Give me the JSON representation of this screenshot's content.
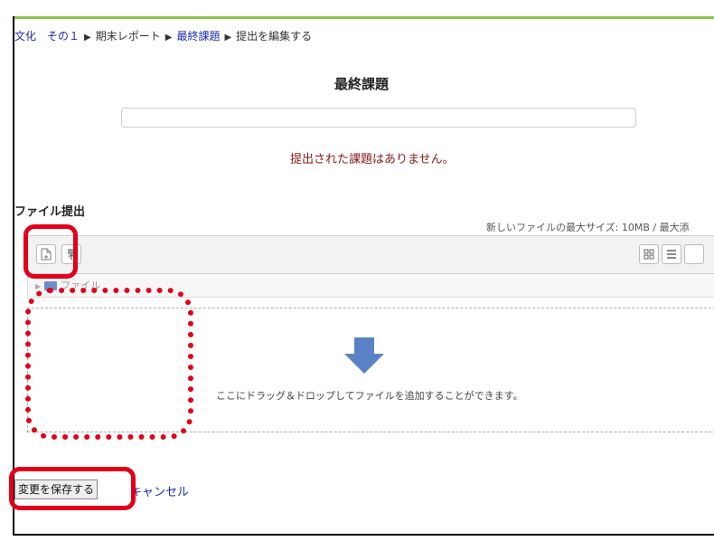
{
  "breadcrumb": {
    "items": [
      {
        "label": "文化　その１",
        "type": "link"
      },
      {
        "label": "期末レポート",
        "type": "plain"
      },
      {
        "label": "最終課題",
        "type": "link"
      },
      {
        "label": "提出を編集する",
        "type": "plain"
      }
    ],
    "separator": "▶"
  },
  "assignment": {
    "title": "最終課題",
    "status_message": "提出された課題はありません。"
  },
  "file_submission": {
    "label": "ファイル提出",
    "max_size_text": "新しいファイルの最大サイズ: 10MB / 最大添",
    "path_label": "ファイル",
    "drop_text": "ここにドラッグ＆ドロップしてファイルを追加することができます。"
  },
  "buttons": {
    "save": "変更を保存する",
    "cancel": "キャンセル"
  },
  "colors": {
    "accent": "#8bc34a",
    "link": "#1a2bb0",
    "status": "#8b1a1a",
    "annotation": "#e3001b",
    "arrow": "#5b82c6"
  },
  "icons": {
    "add_file": "add-file-icon",
    "upload": "upload-icon",
    "grid_view": "grid-view-icon",
    "list_view": "list-view-icon",
    "drop_arrow": "down-arrow-icon"
  }
}
